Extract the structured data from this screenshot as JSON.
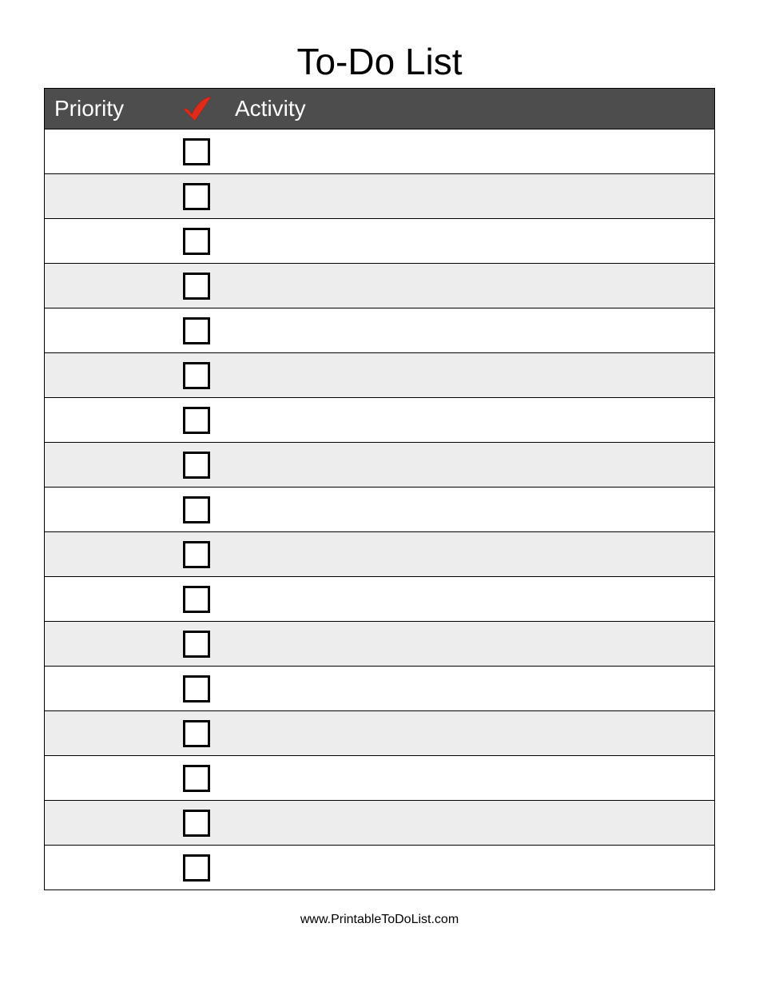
{
  "title": "To-Do List",
  "columns": {
    "priority": "Priority",
    "check": "checkmark-icon",
    "activity": "Activity"
  },
  "rows": [
    {
      "priority": "",
      "checked": false,
      "activity": ""
    },
    {
      "priority": "",
      "checked": false,
      "activity": ""
    },
    {
      "priority": "",
      "checked": false,
      "activity": ""
    },
    {
      "priority": "",
      "checked": false,
      "activity": ""
    },
    {
      "priority": "",
      "checked": false,
      "activity": ""
    },
    {
      "priority": "",
      "checked": false,
      "activity": ""
    },
    {
      "priority": "",
      "checked": false,
      "activity": ""
    },
    {
      "priority": "",
      "checked": false,
      "activity": ""
    },
    {
      "priority": "",
      "checked": false,
      "activity": ""
    },
    {
      "priority": "",
      "checked": false,
      "activity": ""
    },
    {
      "priority": "",
      "checked": false,
      "activity": ""
    },
    {
      "priority": "",
      "checked": false,
      "activity": ""
    },
    {
      "priority": "",
      "checked": false,
      "activity": ""
    },
    {
      "priority": "",
      "checked": false,
      "activity": ""
    },
    {
      "priority": "",
      "checked": false,
      "activity": ""
    },
    {
      "priority": "",
      "checked": false,
      "activity": ""
    },
    {
      "priority": "",
      "checked": false,
      "activity": ""
    }
  ],
  "footer": "www.PrintableToDoList.com",
  "colors": {
    "header_bg": "#4d4d4d",
    "row_even": "#ededed",
    "check_icon": "#e02a1a"
  }
}
